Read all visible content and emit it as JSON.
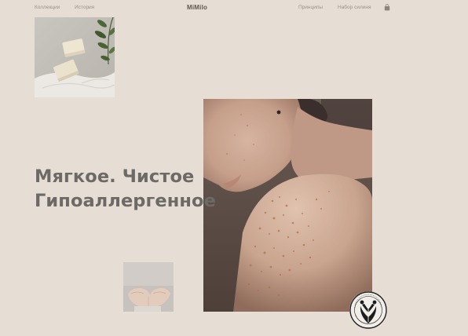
{
  "nav": {
    "left": [
      {
        "label": "Коллекции"
      },
      {
        "label": "История"
      }
    ],
    "brand": "MiMilo",
    "right": [
      {
        "label": "Принципы"
      },
      {
        "label": "Набор силиня"
      }
    ],
    "cart_icon": "shopping-bag-icon"
  },
  "hero": {
    "line1": "Мягкое. Чистое",
    "line2": "Гипоаллергенное"
  },
  "images": {
    "soap": "soap-bars-photo",
    "model": "shoulder-portrait-photo",
    "hands": "open-hands-photo"
  },
  "badge_icon": "certification-seal-icon",
  "colors": {
    "background": "#e6ddd4",
    "headline": "#6c6966",
    "nav_text": "#9a918b"
  }
}
